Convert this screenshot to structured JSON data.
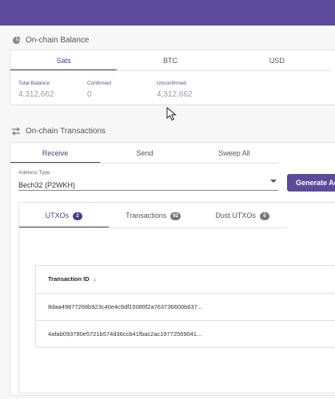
{
  "balance": {
    "title": "On-chain Balance",
    "icon": "pie-chart-icon",
    "tabs": [
      "Sats",
      "BTC",
      "USD"
    ],
    "active_tab": "Sats",
    "total_label": "Total Balance",
    "total_value": "4,312,662",
    "confirmed_label": "Confirmed",
    "confirmed_value": "0",
    "unconfirmed_label": "Unconfirmed",
    "unconfirmed_value": "4,312,662"
  },
  "transactions": {
    "title": "On-chain Transactions",
    "icon": "swap-arrows-icon",
    "tabs": [
      "Receive",
      "Send",
      "Sweep All"
    ],
    "active_tab": "Receive",
    "address_type_label": "Address Type",
    "address_type_value": "Bech32 (P2WKH)",
    "generate_button": "Generate Address",
    "subtabs": [
      {
        "label": "UTXOs",
        "count": "2"
      },
      {
        "label": "Transactions",
        "count": "92"
      },
      {
        "label": "Dust UTXOs",
        "count": "0"
      }
    ],
    "table_header": "Transaction ID",
    "rows": [
      "8daa49877268b923c40e4c9df15089f2a763736600b637...",
      "4afab093780e5721b574d36ccb41fbac2ac19772569041..."
    ]
  },
  "colors": {
    "accent": "#5c4a9d",
    "active_tab": "#4b3b8f"
  }
}
